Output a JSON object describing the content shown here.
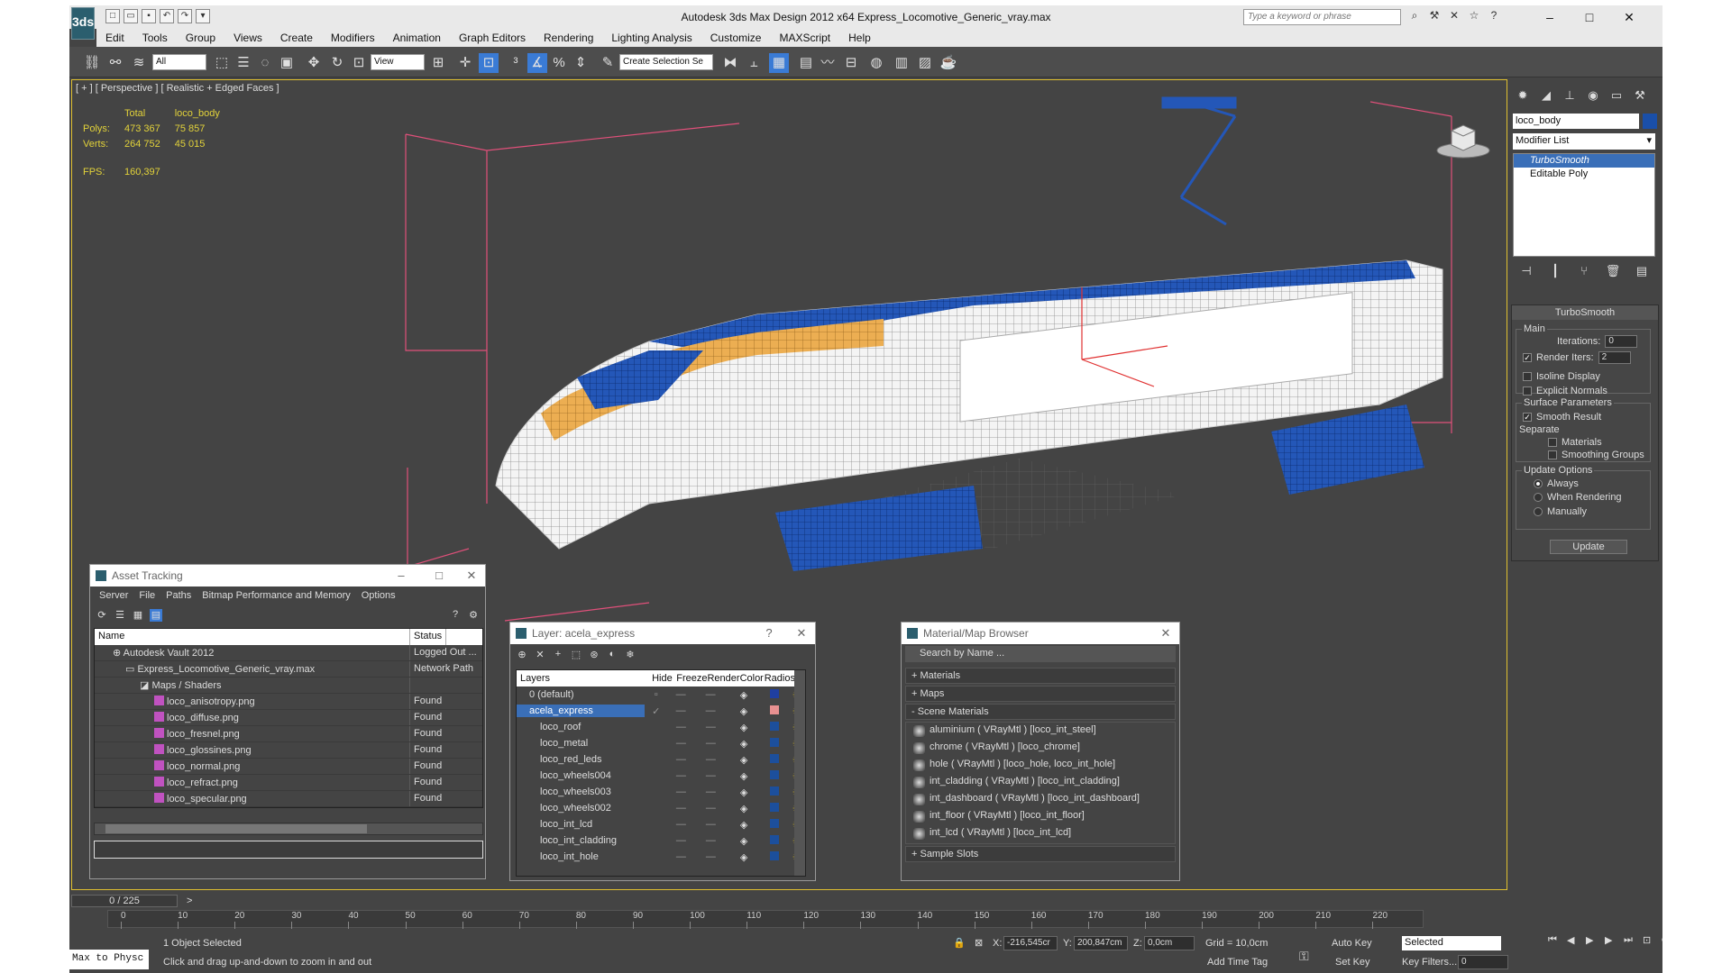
{
  "window": {
    "title": "Autodesk 3ds Max Design 2012 x64      Express_Locomotive_Generic_vray.max",
    "search_placeholder": "Type a keyword or phrase",
    "logo": "3ds"
  },
  "menu": [
    "Edit",
    "Tools",
    "Group",
    "Views",
    "Create",
    "Modifiers",
    "Animation",
    "Graph Editors",
    "Rendering",
    "Lighting Analysis",
    "Customize",
    "MAXScript",
    "Help"
  ],
  "toolbar": {
    "selection_filter": "All",
    "ref_coord": "View",
    "named_selection": "Create Selection Se"
  },
  "viewport": {
    "label": "[ + ] [ Perspective ] [ Realistic + Edged Faces ]",
    "stats": {
      "col_total": "Total",
      "col_object": "loco_body",
      "polys_label": "Polys:",
      "polys_total": "473 367",
      "polys_object": "75 857",
      "verts_label": "Verts:",
      "verts_total": "264 752",
      "verts_object": "45 015",
      "fps_label": "FPS:",
      "fps_value": "160,397"
    },
    "colors": {
      "wire_white": "#f2f2f2",
      "wire_blue": "#1c50b0",
      "wire_orange": "#e8a040",
      "bbox": "#e0507a"
    }
  },
  "command_panel": {
    "object_name": "loco_body",
    "modifier_list": "Modifier List",
    "stack": [
      "TurboSmooth",
      "Editable Poly"
    ],
    "rollout_title": "TurboSmooth",
    "main_group": "Main",
    "iterations_label": "Iterations:",
    "iterations_value": "0",
    "render_iters_label": "Render Iters:",
    "render_iters_value": "2",
    "isoline": "Isoline Display",
    "explicit_normals": "Explicit Normals",
    "surface_group": "Surface Parameters",
    "smooth_result": "Smooth Result",
    "separate": "Separate",
    "materials": "Materials",
    "smoothing_groups": "Smoothing Groups",
    "update_group": "Update Options",
    "always": "Always",
    "when_rendering": "When Rendering",
    "manually": "Manually",
    "update_btn": "Update"
  },
  "asset_tracking": {
    "title": "Asset Tracking",
    "menu": [
      "Server",
      "File",
      "Paths",
      "Bitmap Performance and Memory",
      "Options"
    ],
    "col_name": "Name",
    "col_status": "Status",
    "rows": [
      {
        "name": "Autodesk Vault 2012",
        "status": "Logged Out ..."
      },
      {
        "name": "Express_Locomotive_Generic_vray.max",
        "status": "Network Path"
      },
      {
        "name": "Maps / Shaders",
        "status": ""
      },
      {
        "name": "loco_anisotropy.png",
        "status": "Found"
      },
      {
        "name": "loco_diffuse.png",
        "status": "Found"
      },
      {
        "name": "loco_fresnel.png",
        "status": "Found"
      },
      {
        "name": "loco_glossines.png",
        "status": "Found"
      },
      {
        "name": "loco_normal.png",
        "status": "Found"
      },
      {
        "name": "loco_refract.png",
        "status": "Found"
      },
      {
        "name": "loco_specular.png",
        "status": "Found"
      }
    ]
  },
  "layer_dialog": {
    "title": "Layer: acela_express",
    "col_layers": "Layers",
    "col_hide": "Hide",
    "col_freeze": "Freeze",
    "col_render": "Render",
    "col_color": "Color",
    "col_radiosity": "Radiosity",
    "rows": [
      {
        "name": "0 (default)",
        "color": "#1f3fa0"
      },
      {
        "name": "acela_express",
        "color": "#e89090"
      },
      {
        "name": "loco_roof",
        "color": "#1c4f9c"
      },
      {
        "name": "loco_metal",
        "color": "#1c4f9c"
      },
      {
        "name": "loco_red_leds",
        "color": "#1c4f9c"
      },
      {
        "name": "loco_wheels004",
        "color": "#1c4f9c"
      },
      {
        "name": "loco_wheels003",
        "color": "#1c4f9c"
      },
      {
        "name": "loco_wheels002",
        "color": "#1c4f9c"
      },
      {
        "name": "loco_int_lcd",
        "color": "#1c4f9c"
      },
      {
        "name": "loco_int_cladding",
        "color": "#1c4f9c"
      },
      {
        "name": "loco_int_hole",
        "color": "#1c4f9c"
      }
    ]
  },
  "material_browser": {
    "title": "Material/Map Browser",
    "search": "Search by Name ...",
    "sec_materials": "+ Materials",
    "sec_maps": "+ Maps",
    "sec_scene": "- Scene Materials",
    "items": [
      "aluminium ( VRayMtl ) [loco_int_steel]",
      "chrome ( VRayMtl ) [loco_chrome]",
      "hole ( VRayMtl ) [loco_hole, loco_int_hole]",
      "int_cladding ( VRayMtl ) [loco_int_cladding]",
      "int_dashboard ( VRayMtl ) [loco_int_dashboard]",
      "int_floor ( VRayMtl ) [loco_int_floor]",
      "int_lcd ( VRayMtl ) [loco_int_lcd]"
    ],
    "sec_sample": "+ Sample Slots"
  },
  "timeline": {
    "frame": "0 / 225",
    "ticks": [
      "0",
      "10",
      "20",
      "30",
      "40",
      "50",
      "60",
      "70",
      "80",
      "90",
      "100",
      "110",
      "120",
      "130",
      "140",
      "150",
      "160",
      "170",
      "180",
      "190",
      "200",
      "210",
      "220"
    ]
  },
  "status": {
    "maxscript": "Max to Physc",
    "selected": "1 Object Selected",
    "prompt": "Click and drag up-and-down to zoom in and out",
    "x_label": "X:",
    "x": "-216,545cr",
    "y_label": "Y:",
    "y": "200,847cm",
    "z_label": "Z:",
    "z": "0,0cm",
    "grid": "Grid = 10,0cm",
    "auto_key": "Auto Key",
    "set_key": "Set Key",
    "key_mode": "Selected",
    "key_filters": "Key Filters...",
    "add_time_tag": "Add Time Tag",
    "current_frame": "0"
  }
}
